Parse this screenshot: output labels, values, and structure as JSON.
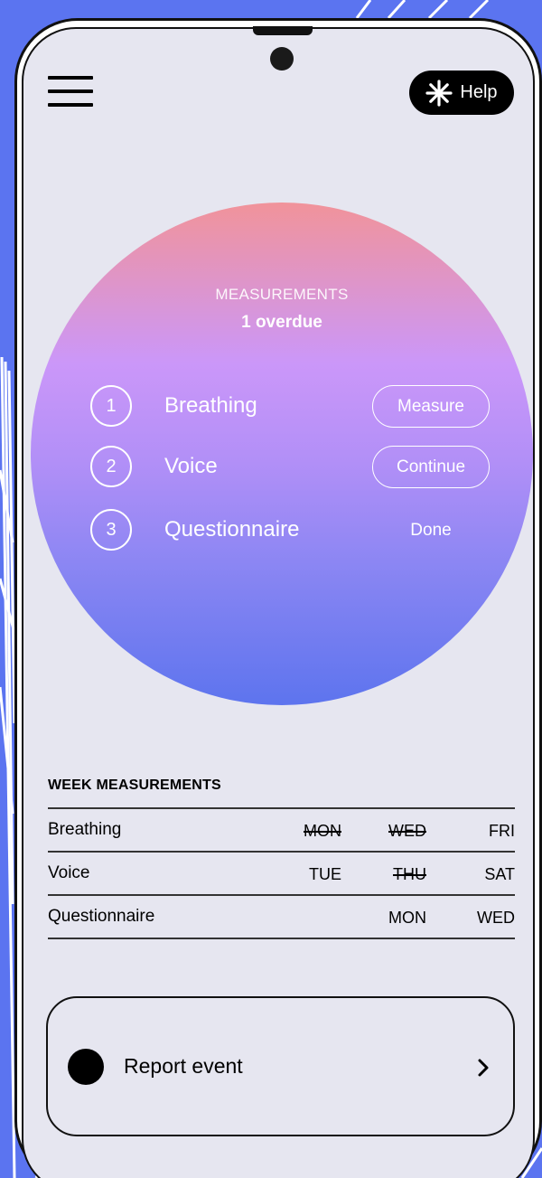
{
  "header": {
    "help_label": "Help"
  },
  "measurements": {
    "title": "MEASUREMENTS",
    "status": "1 overdue",
    "items": [
      {
        "number": "1",
        "name": "Breathing",
        "action": "Measure"
      },
      {
        "number": "2",
        "name": "Voice",
        "action": "Continue"
      },
      {
        "number": "3",
        "name": "Questionnaire",
        "action": "Done"
      }
    ]
  },
  "week": {
    "title": "WEEK MEASUREMENTS",
    "rows": [
      {
        "name": "Breathing",
        "days": [
          "MON",
          "WED",
          "FRI"
        ]
      },
      {
        "name": "Voice",
        "days": [
          "TUE",
          "THU",
          "SAT"
        ]
      },
      {
        "name": "Questionnaire",
        "days": [
          "",
          "MON",
          "WED"
        ]
      }
    ]
  },
  "report": {
    "label": "Report event"
  },
  "colors": {
    "background": "#5b74f0",
    "screen": "#e6e6f0",
    "gradient_top": "#f1939a",
    "gradient_mid": "#cb97f9",
    "gradient_bottom": "#5d74ee"
  },
  "icons": {
    "menu": "hamburger-menu-icon",
    "help": "asterisk-icon",
    "report": "filled-circle-icon",
    "chevron": "chevron-right-icon"
  }
}
